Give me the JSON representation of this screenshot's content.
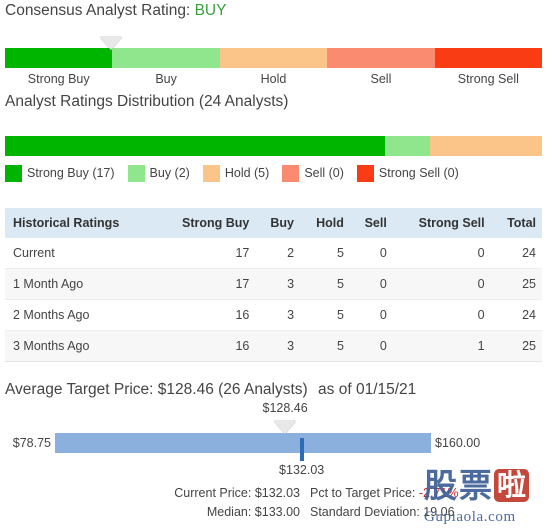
{
  "consensus": {
    "label": "Consensus Analyst Rating:",
    "value": "BUY",
    "value_color": "#36a03b",
    "pointer_percent": 19.8,
    "segments": [
      {
        "label": "Strong Buy",
        "color": "#00b500"
      },
      {
        "label": "Buy",
        "color": "#90e68c"
      },
      {
        "label": "Hold",
        "color": "#fbc58a"
      },
      {
        "label": "Sell",
        "color": "#fa8a70"
      },
      {
        "label": "Strong Sell",
        "color": "#fa3c14"
      }
    ]
  },
  "distribution": {
    "heading": "Analyst Ratings Distribution (24 Analysts)",
    "total": 24,
    "legend": [
      {
        "label": "Strong Buy (17)",
        "count": 17,
        "color": "#00b500",
        "percent": 70.8
      },
      {
        "label": "Buy (2)",
        "count": 2,
        "color": "#90e68c",
        "percent": 8.3
      },
      {
        "label": "Hold (5)",
        "count": 5,
        "color": "#fbc58a",
        "percent": 20.9
      },
      {
        "label": "Sell (0)",
        "count": 0,
        "color": "#fa8a70",
        "percent": 0
      },
      {
        "label": "Strong Sell (0)",
        "count": 0,
        "color": "#fa3c14",
        "percent": 0
      }
    ]
  },
  "historical_table": {
    "headers": [
      "Historical Ratings",
      "Strong Buy",
      "Buy",
      "Hold",
      "Sell",
      "Strong Sell",
      "Total"
    ],
    "rows": [
      {
        "period": "Current",
        "strong_buy": "17",
        "buy": "2",
        "hold": "5",
        "sell": "0",
        "strong_sell": "0",
        "total": "24"
      },
      {
        "period": "1 Month Ago",
        "strong_buy": "17",
        "buy": "3",
        "hold": "5",
        "sell": "0",
        "strong_sell": "0",
        "total": "25"
      },
      {
        "period": "2 Months Ago",
        "strong_buy": "16",
        "buy": "3",
        "hold": "5",
        "sell": "0",
        "strong_sell": "0",
        "total": "24"
      },
      {
        "period": "3 Months Ago",
        "strong_buy": "16",
        "buy": "3",
        "hold": "5",
        "sell": "0",
        "strong_sell": "1",
        "total": "25"
      }
    ]
  },
  "target_price": {
    "heading": "Average Target Price: $128.46 (26 Analysts)",
    "as_of": "as of 01/15/21",
    "low": "$78.75",
    "high": "$160.00",
    "average_label": "$128.46",
    "average_percent": 61.2,
    "current_label": "$132.03",
    "current_percent": 65.6,
    "bar_color": "#8cb0dd",
    "current_marker_color": "#2c6bb5"
  },
  "stats": {
    "current_price_label": "Current Price: $132.03",
    "pct_to_target_prefix": "Pct to Target Price:",
    "pct_to_target_value": "-2.71%",
    "pct_to_target_color": "#cc2222",
    "median_label": "Median: $133.00",
    "standard_deviation_label": "Standard Deviation: 19.06"
  },
  "watermark": {
    "char1": "股",
    "char2": "票",
    "char3": "啦",
    "domain": "Gupiaola.com"
  }
}
